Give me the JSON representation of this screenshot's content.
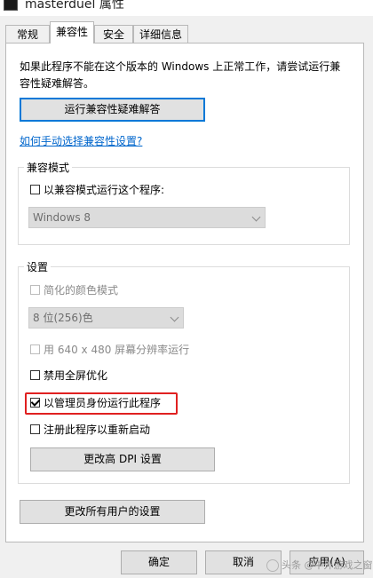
{
  "window": {
    "title": "masterduel 属性"
  },
  "tabs": [
    {
      "label": "常规",
      "active": false
    },
    {
      "label": "兼容性",
      "active": true
    },
    {
      "label": "安全",
      "active": false
    },
    {
      "label": "详细信息",
      "active": false
    }
  ],
  "description": "如果此程序不能在这个版本的 Windows 上正常工作，请尝试运行兼容性疑难解答。",
  "troubleshooter_button": "运行兼容性疑难解答",
  "manual_link": "如何手动选择兼容性设置?",
  "compat_mode": {
    "group_label": "兼容模式",
    "checkbox_label": "以兼容模式运行这个程序:",
    "checked": false,
    "select_value": "Windows 8"
  },
  "settings": {
    "group_label": "设置",
    "reduced_color": {
      "label": "简化的颜色模式",
      "checked": false,
      "disabled": true
    },
    "color_select": "8 位(256)色",
    "res_640": {
      "label": "用 640 x 480 屏幕分辨率运行",
      "checked": false,
      "disabled": true
    },
    "disable_fullscreen": {
      "label": "禁用全屏优化",
      "checked": false,
      "disabled": false
    },
    "run_as_admin": {
      "label": "以管理员身份运行此程序",
      "checked": true,
      "disabled": false
    },
    "register_restart": {
      "label": "注册此程序以重新启动",
      "checked": false,
      "disabled": false
    },
    "dpi_button": "更改高 DPI 设置"
  },
  "all_users_button": "更改所有用户的设置",
  "buttons": {
    "ok": "确定",
    "cancel": "取消",
    "apply": "应用(A)"
  },
  "watermark": "头条 @中外游戏之窗",
  "colors": {
    "link": "#0066cc",
    "highlight": "#e02020",
    "focus": "#0078d7"
  }
}
